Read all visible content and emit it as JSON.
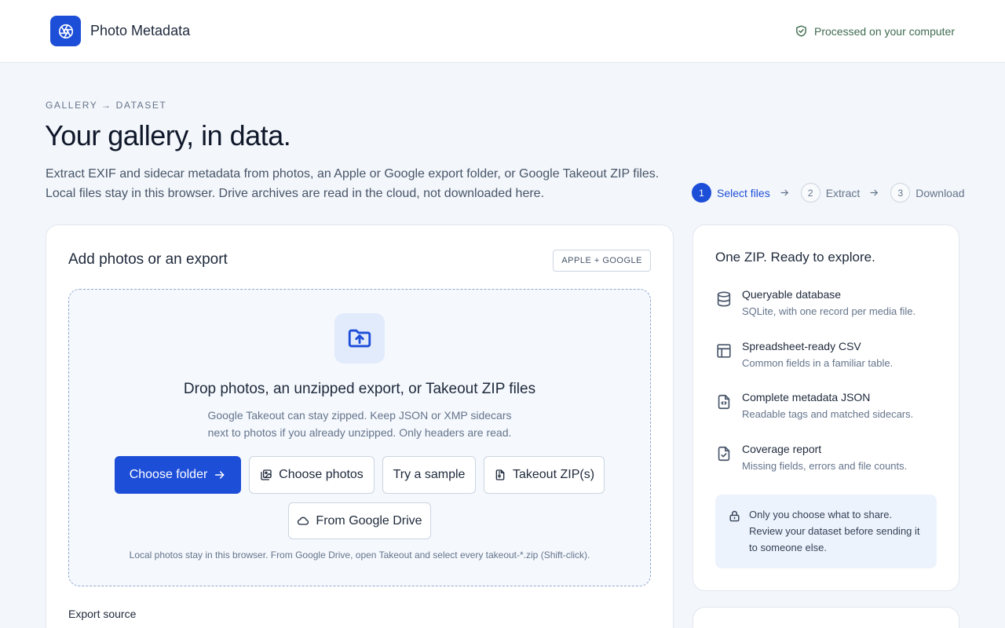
{
  "header": {
    "app_title": "Photo Metadata",
    "privacy_label": "Processed on your computer"
  },
  "hero": {
    "eyebrow": "GALLERY → DATASET",
    "title": "Your gallery, in data.",
    "subtitle_line1": "Extract EXIF and sidecar metadata from photos, an Apple or Google export folder, or Google Takeout ZIP files.",
    "subtitle_line2": "Local files stay in this browser. Drive archives are read in the cloud, not downloaded here."
  },
  "steps": [
    {
      "num": "1",
      "label": "Select files",
      "active": true
    },
    {
      "num": "2",
      "label": "Extract",
      "active": false
    },
    {
      "num": "3",
      "label": "Download",
      "active": false
    }
  ],
  "upload": {
    "title": "Add photos or an export",
    "badge": "APPLE + GOOGLE",
    "drop_title": "Drop photos, an unzipped export, or Takeout ZIP files",
    "drop_sub_line1": "Google Takeout can stay zipped. Keep JSON or XMP sidecars",
    "drop_sub_line2": "next to photos if you already unzipped. Only headers are read.",
    "buttons": {
      "choose_folder": "Choose folder",
      "choose_photos": "Choose photos",
      "try_sample": "Try a sample",
      "takeout_zip": "Takeout ZIP(s)",
      "google_drive": "From Google Drive"
    },
    "note": "Local photos stay in this browser. From Google Drive, open Takeout and select every takeout-*.zip (Shift-click).",
    "export_source_label": "Export source"
  },
  "output": {
    "title": "One ZIP. Ready to explore.",
    "features": [
      {
        "icon": "database-icon",
        "title": "Queryable database",
        "desc": "SQLite, with one record per media file."
      },
      {
        "icon": "table-icon",
        "title": "Spreadsheet-ready CSV",
        "desc": "Common fields in a familiar table."
      },
      {
        "icon": "json-file-icon",
        "title": "Complete metadata JSON",
        "desc": "Readable tags and matched sidecars."
      },
      {
        "icon": "report-file-icon",
        "title": "Coverage report",
        "desc": "Missing fields, errors and file counts."
      }
    ],
    "notice": "Only you choose what to share. Review your dataset before sending it to someone else."
  },
  "colors": {
    "accent": "#1d4ed8",
    "background": "#f3f6fa",
    "privacy_green": "#3f6b4f"
  }
}
